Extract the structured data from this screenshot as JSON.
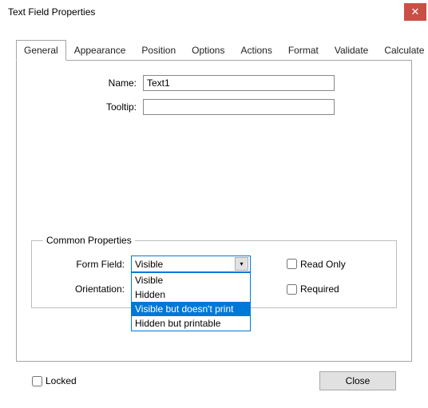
{
  "window": {
    "title": "Text Field Properties"
  },
  "tabs": {
    "items": [
      {
        "label": "General"
      },
      {
        "label": "Appearance"
      },
      {
        "label": "Position"
      },
      {
        "label": "Options"
      },
      {
        "label": "Actions"
      },
      {
        "label": "Format"
      },
      {
        "label": "Validate"
      },
      {
        "label": "Calculate"
      }
    ]
  },
  "general": {
    "name_label": "Name:",
    "name_value": "Text1",
    "tooltip_label": "Tooltip:",
    "tooltip_value": ""
  },
  "common": {
    "legend": "Common Properties",
    "form_field_label": "Form Field:",
    "form_field_value": "Visible",
    "form_field_options": {
      "0": "Visible",
      "1": "Hidden",
      "2": "Visible but doesn't print",
      "3": "Hidden but printable"
    },
    "orientation_label": "Orientation:",
    "read_only_label": "Read Only",
    "required_label": "Required"
  },
  "footer": {
    "locked_label": "Locked",
    "close_label": "Close"
  }
}
